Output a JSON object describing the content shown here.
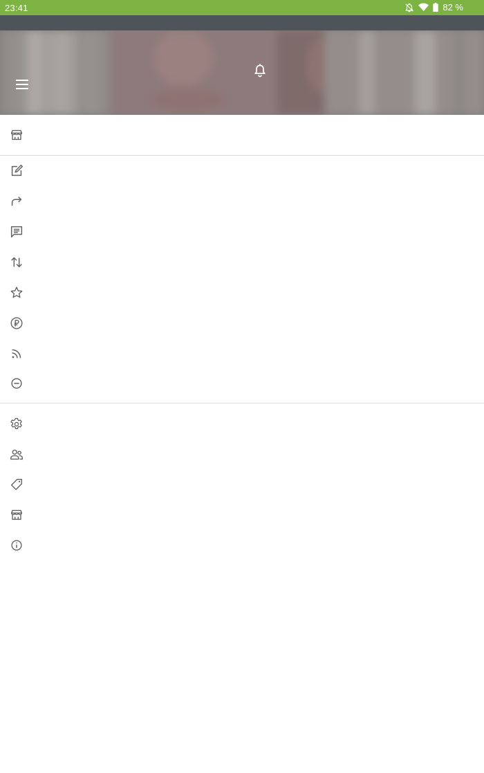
{
  "status_bar": {
    "time": "23:41",
    "battery": "82 %",
    "icons": [
      "notifications-off-icon",
      "wifi-icon",
      "battery-icon"
    ]
  },
  "header": {
    "menu_icon": "menu-icon",
    "notification_icon": "bell-icon"
  },
  "drawer": {
    "top_items": [
      {
        "icon": "store-icon"
      }
    ],
    "main_items": [
      {
        "icon": "edit-icon"
      },
      {
        "icon": "share-icon"
      },
      {
        "icon": "comment-icon"
      },
      {
        "icon": "sort-icon"
      },
      {
        "icon": "star-icon"
      },
      {
        "icon": "ruble-icon"
      },
      {
        "icon": "rss-icon"
      },
      {
        "icon": "block-icon"
      }
    ],
    "bottom_items": [
      {
        "icon": "settings-icon"
      },
      {
        "icon": "people-icon"
      },
      {
        "icon": "tag-icon"
      },
      {
        "icon": "store-icon"
      },
      {
        "icon": "info-icon"
      }
    ]
  },
  "colors": {
    "status_bar": "#7cb342",
    "toolbar_strip": "#4f535a",
    "icon": "#616161",
    "divider": "#dadada"
  }
}
